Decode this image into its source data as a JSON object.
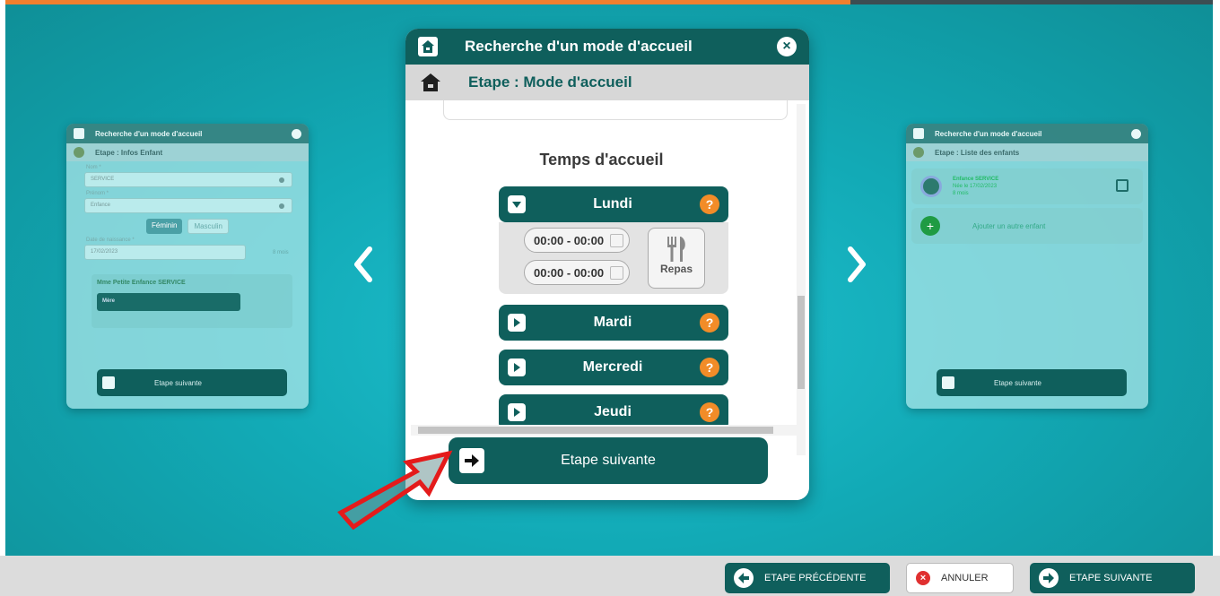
{
  "progress": {
    "fraction": 0.7
  },
  "main": {
    "title": "Recherche d'un mode d'accueil",
    "close_label": "×",
    "step": "Etape : Mode d'accueil",
    "section_title": "Temps d'accueil",
    "days": [
      {
        "name": "Lundi",
        "expanded": true,
        "help": "?"
      },
      {
        "name": "Mardi",
        "expanded": false,
        "help": "?"
      },
      {
        "name": "Mercredi",
        "expanded": false,
        "help": "?"
      },
      {
        "name": "Jeudi",
        "expanded": false,
        "help": "?"
      }
    ],
    "slots": [
      "00:00 - 00:00",
      "00:00 - 00:00"
    ],
    "meal_label": "Repas",
    "next_label": "Etape suivante"
  },
  "left_card": {
    "title": "Recherche d'un mode d'accueil",
    "step": "Etape : Infos Enfant",
    "nom_label": "Nom *",
    "nom_value": "SERVICE",
    "prenom_label": "Prénom *",
    "prenom_value": "Enfance",
    "gender_female": "Féminin",
    "gender_male": "Masculin",
    "dob_label": "Date de naissance *",
    "dob_value": "17/02/2023",
    "age": "8 mois",
    "parent_name": "Mme Petite Enfance SERVICE",
    "relation": "Mère",
    "next_label": "Etape suivante"
  },
  "right_card": {
    "title": "Recherche d'un mode d'accueil",
    "step": "Etape : Liste des enfants",
    "child_name": "Enfance SERVICE",
    "child_dob": "Née le 17/02/2023",
    "child_age": "8 mois",
    "add_label": "Ajouter un autre enfant",
    "next_label": "Etape suivante"
  },
  "bottom_bar": {
    "prev_label": "ETAPE PRÉCÉDENTE",
    "cancel_label": "ANNULER",
    "next_label": "ETAPE SUIVANTE"
  },
  "colors": {
    "accent": "#0f5f5c",
    "progress": "#f07f2e",
    "help": "#f28c28",
    "cancel": "#e03030"
  }
}
